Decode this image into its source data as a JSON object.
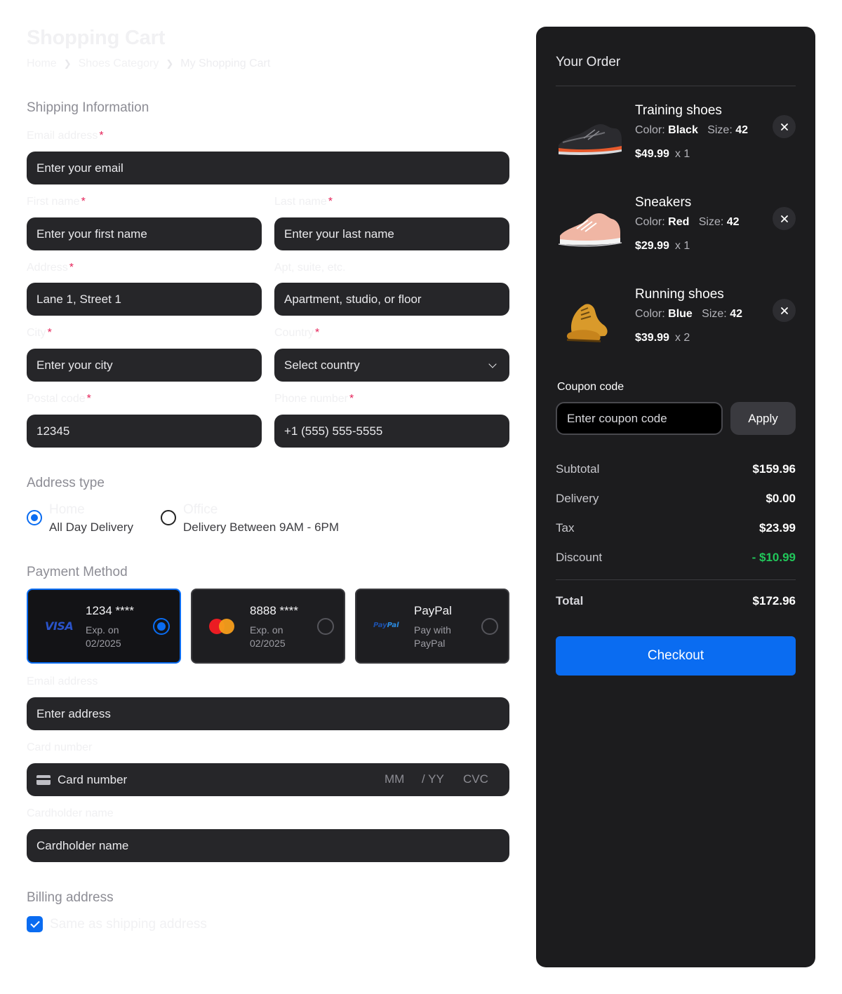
{
  "header": {
    "title": "Shopping Cart",
    "breadcrumb": [
      "Home",
      "Shoes Category",
      "My Shopping Cart"
    ]
  },
  "shipping": {
    "section_title": "Shipping Information",
    "email": {
      "label": "Email address",
      "placeholder": "Enter your email"
    },
    "first_name": {
      "label": "First name",
      "placeholder": "Enter your first name"
    },
    "last_name": {
      "label": "Last name",
      "placeholder": "Enter your last name"
    },
    "address": {
      "label": "Address",
      "value": "Lane 1, Street 1"
    },
    "apt": {
      "label": "Apt, suite, etc.",
      "placeholder": "Apartment, studio, or floor"
    },
    "city": {
      "label": "City",
      "placeholder": "Enter your city"
    },
    "country": {
      "label": "Country",
      "placeholder": "Select country"
    },
    "postal": {
      "label": "Postal code",
      "value": "12345"
    },
    "phone": {
      "label": "Phone number",
      "value": "+1 (555) 555-5555"
    },
    "required_mark": "*"
  },
  "address_type": {
    "title": "Address type",
    "options": [
      {
        "label": "Home",
        "desc": "All Day Delivery",
        "selected": true
      },
      {
        "label": "Office",
        "desc": "Delivery Between 9AM - 6PM",
        "selected": false
      }
    ]
  },
  "payment": {
    "title": "Payment Method",
    "cards": [
      {
        "brand": "VISA",
        "number": "1234 ****",
        "line1": "Exp. on",
        "line2": "02/2025",
        "selected": true
      },
      {
        "brand": "mastercard",
        "number": "8888 ****",
        "line1": "Exp. on",
        "line2": "02/2025",
        "selected": false
      },
      {
        "brand": "PayPal",
        "brand_a": "Pay",
        "brand_b": "Pal",
        "number": "PayPal",
        "line1": "Pay with",
        "line2": "PayPal",
        "selected": false
      }
    ],
    "email": {
      "label": "Email address",
      "placeholder": "Enter address"
    },
    "card_number": {
      "label": "Card number",
      "placeholder": "Card number",
      "mm": "MM",
      "yy": "/ YY",
      "cvc": "CVC"
    },
    "cardholder": {
      "label": "Cardholder name",
      "placeholder": "Cardholder name"
    }
  },
  "billing": {
    "title": "Billing address",
    "same_as_shipping": "Same as shipping address",
    "checked": true
  },
  "order": {
    "title": "Your Order",
    "items": [
      {
        "name": "Training shoes",
        "color_label": "Color:",
        "color": "Black",
        "size_label": "Size:",
        "size": "42",
        "price": "$49.99",
        "qty": "x 1"
      },
      {
        "name": "Sneakers",
        "color_label": "Color:",
        "color": "Red",
        "size_label": "Size:",
        "size": "42",
        "price": "$29.99",
        "qty": "x 1"
      },
      {
        "name": "Running shoes",
        "color_label": "Color:",
        "color": "Blue",
        "size_label": "Size:",
        "size": "42",
        "price": "$39.99",
        "qty": "x 2"
      }
    ],
    "coupon": {
      "label": "Coupon code",
      "placeholder": "Enter coupon code",
      "apply": "Apply"
    },
    "summary": {
      "subtotal_label": "Subtotal",
      "subtotal": "$159.96",
      "delivery_label": "Delivery",
      "delivery": "$0.00",
      "tax_label": "Tax",
      "tax": "$23.99",
      "discount_label": "Discount",
      "discount": "- $10.99",
      "total_label": "Total",
      "total": "$172.96"
    },
    "checkout": "Checkout"
  },
  "colors": {
    "accent": "#0a6cf1",
    "panel": "#1c1c1e",
    "input": "#262629",
    "discount_green": "#21c65a",
    "required_red": "#e5245a"
  }
}
